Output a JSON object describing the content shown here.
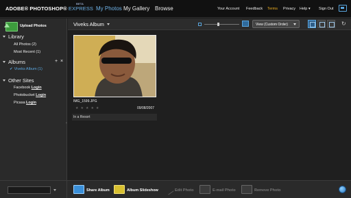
{
  "header": {
    "logo": "ADOBE® PHOTOSHOP® EXPRESS",
    "logo_brand": "ADOBE® PHOTOSHOP®",
    "logo_product": "EXPRESS",
    "beta": "BETA",
    "nav": [
      "My Photos",
      "My Gallery",
      "Browse"
    ],
    "links": [
      "Your Account",
      "Feedback",
      "Terms",
      "Privacy",
      "Help",
      "Sign Out"
    ],
    "accent": "#6fb3e8",
    "terms_color": "#f0b020"
  },
  "sidebar": {
    "upload_label": "Upload Photos",
    "library_heading": "Library",
    "library_items": [
      "All Photos (2)",
      "Most Recent (1)"
    ],
    "albums_heading": "Albums",
    "albums_items": [
      "Viveks Album (1)"
    ],
    "other_heading": "Other Sites",
    "other_sites": [
      {
        "name": "Facebook",
        "action": "Login"
      },
      {
        "name": "Photobucket",
        "action": "Login"
      },
      {
        "name": "Picasa",
        "action": "Login"
      }
    ]
  },
  "toolbar": {
    "album_title": "Viveks Album",
    "view_select": "View (Custom Order)",
    "zoom_level": 0.4
  },
  "photo": {
    "filename": "IMG_1599.JPG",
    "stars": "★★★★★",
    "rating": 0,
    "date": "09/08/2007",
    "caption": "In a Resort"
  },
  "bottom": {
    "actions": [
      "Share Album",
      "Album Slideshow",
      "Edit Photo",
      "E-mail Photo",
      "Remove Photo"
    ]
  }
}
